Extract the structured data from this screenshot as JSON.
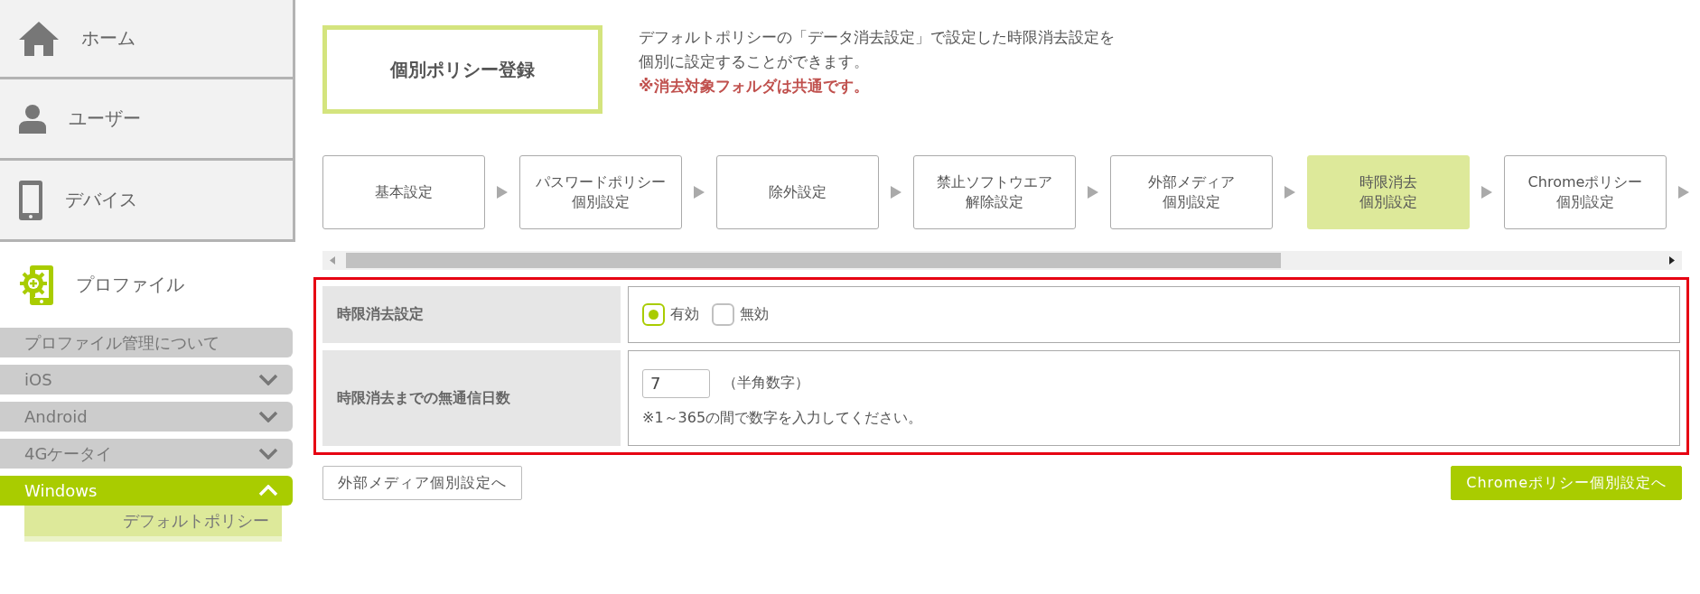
{
  "sidebar": {
    "nav": [
      {
        "label": "ホーム",
        "selected": false
      },
      {
        "label": "ユーザー",
        "selected": false
      },
      {
        "label": "デバイス",
        "selected": false
      },
      {
        "label": "プロファイル",
        "selected": true
      }
    ],
    "submenu": [
      {
        "label": "プロファイル管理について",
        "expandable": false,
        "selected": false
      },
      {
        "label": "iOS",
        "expandable": true,
        "expanded": false,
        "selected": false
      },
      {
        "label": "Android",
        "expandable": true,
        "expanded": false,
        "selected": false
      },
      {
        "label": "4Gケータイ",
        "expandable": true,
        "expanded": false,
        "selected": false
      },
      {
        "label": "Windows",
        "expandable": true,
        "expanded": true,
        "selected": true,
        "children": [
          {
            "label": "デフォルトポリシー",
            "selected": true
          }
        ]
      }
    ]
  },
  "header": {
    "title": "個別ポリシー登録",
    "description": [
      "デフォルトポリシーの「データ消去設定」で設定した時限消去設定を",
      "個別に設定することができます。"
    ],
    "note": "※消去対象フォルダは共通です。"
  },
  "steps": [
    {
      "lines": [
        "基本設定"
      ],
      "selected": false
    },
    {
      "lines": [
        "パスワードポリシー",
        "個別設定"
      ],
      "selected": false
    },
    {
      "lines": [
        "除外設定"
      ],
      "selected": false
    },
    {
      "lines": [
        "禁止ソフトウエア",
        "解除設定"
      ],
      "selected": false
    },
    {
      "lines": [
        "外部メディア",
        "個別設定"
      ],
      "selected": false
    },
    {
      "lines": [
        "時限消去",
        "個別設定"
      ],
      "selected": true
    },
    {
      "lines": [
        "Chromeポリシー",
        "個別設定"
      ],
      "selected": false
    }
  ],
  "form": {
    "rows": [
      {
        "kind": "radio",
        "label": "時限消去設定",
        "options": [
          {
            "label": "有効",
            "selected": true
          },
          {
            "label": "無効",
            "selected": false
          }
        ]
      },
      {
        "kind": "number",
        "label": "時限消去までの無通信日数",
        "value": "7",
        "suffix": "（半角数字）",
        "hint": "※1～365の間で数字を入力してください。"
      }
    ]
  },
  "buttons": {
    "back": "外部メディア個別設定へ",
    "next": "Chromeポリシー個別設定へ"
  }
}
